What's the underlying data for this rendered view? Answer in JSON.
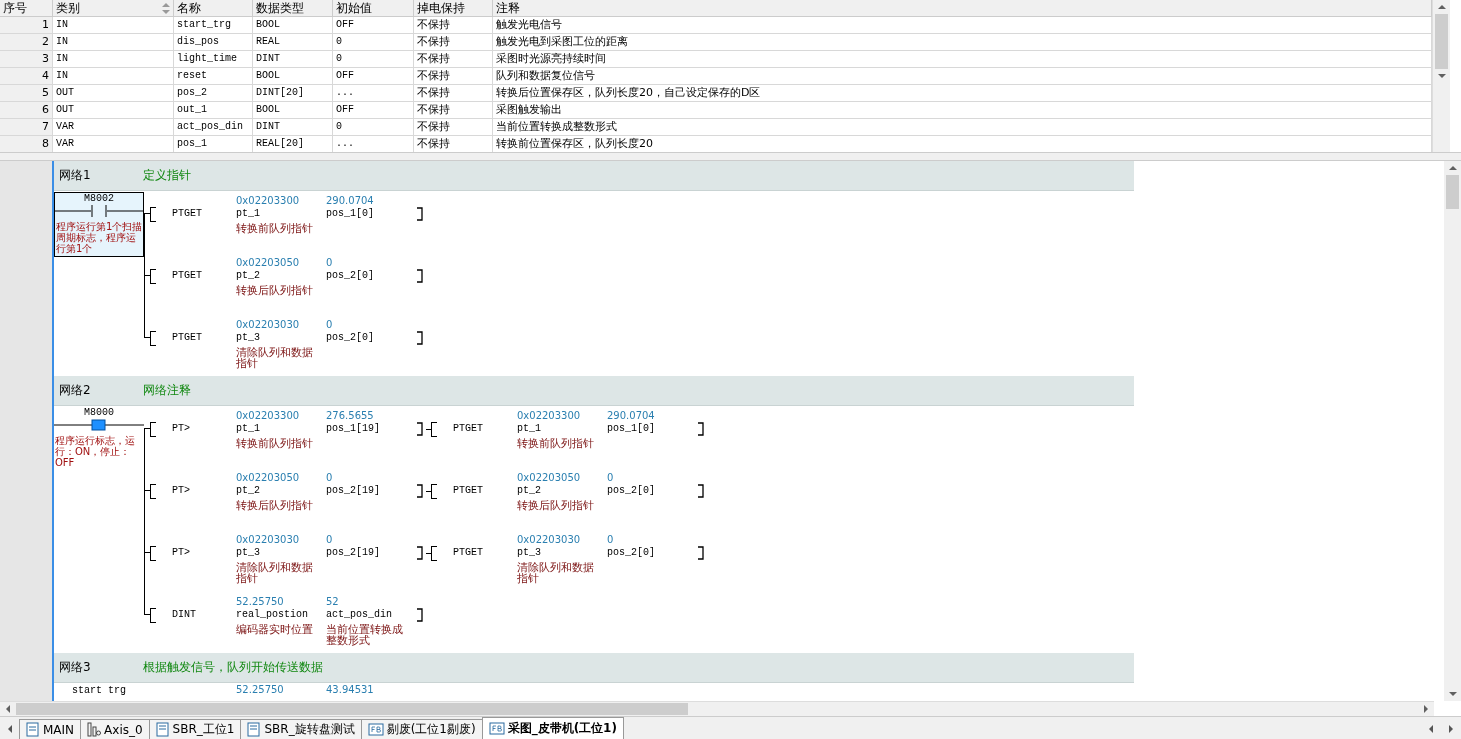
{
  "variable_table": {
    "columns": [
      {
        "label": "序号",
        "sortable": false
      },
      {
        "label": "类别",
        "sortable": true
      },
      {
        "label": "名称",
        "sortable": false
      },
      {
        "label": "数据类型",
        "sortable": false
      },
      {
        "label": "初始值",
        "sortable": false
      },
      {
        "label": "掉电保持",
        "sortable": false
      },
      {
        "label": "注释",
        "sortable": false
      }
    ],
    "rows": [
      {
        "index": "1",
        "category": "IN",
        "name": "start_trg",
        "type": "BOOL",
        "initial": "OFF",
        "retain": "不保持",
        "comment": "触发光电信号"
      },
      {
        "index": "2",
        "category": "IN",
        "name": "dis_pos",
        "type": "REAL",
        "initial": "0",
        "retain": "不保持",
        "comment": "触发光电到采图工位的距离"
      },
      {
        "index": "3",
        "category": "IN",
        "name": "light_time",
        "type": "DINT",
        "initial": "0",
        "retain": "不保持",
        "comment": "采图时光源亮持续时间"
      },
      {
        "index": "4",
        "category": "IN",
        "name": "reset",
        "type": "BOOL",
        "initial": "OFF",
        "retain": "不保持",
        "comment": "队列和数据复位信号"
      },
      {
        "index": "5",
        "category": "OUT",
        "name": "pos_2",
        "type": "DINT[20]",
        "initial": "...",
        "retain": "不保持",
        "comment": "转换后位置保存区，队列长度20，自己设定保存的D区"
      },
      {
        "index": "6",
        "category": "OUT",
        "name": "out_1",
        "type": "BOOL",
        "initial": "OFF",
        "retain": "不保持",
        "comment": "采图触发输出"
      },
      {
        "index": "7",
        "category": "VAR",
        "name": "act_pos_din",
        "type": "DINT",
        "initial": "0",
        "retain": "不保持",
        "comment": "当前位置转换成整数形式"
      },
      {
        "index": "8",
        "category": "VAR",
        "name": "pos_1",
        "type": "REAL[20]",
        "initial": "...",
        "retain": "不保持",
        "comment": "转换前位置保存区，队列长度20"
      }
    ]
  },
  "networks": [
    {
      "label": "网络1",
      "comment": "定义指针",
      "contact": {
        "address": "M8002",
        "comment": "程序运行第1个扫描周期标志，程序运行第1个",
        "selected": true,
        "energized": false
      },
      "rungs": [
        {
          "instructions": [
            {
              "op": "PTGET",
              "params": [
                {
                  "value": "0x02203300",
                  "name": "pt_1",
                  "comment": "转换前队列指针"
                },
                {
                  "value": "290.0704",
                  "name": "pos_1[0]"
                }
              ]
            }
          ]
        },
        {
          "instructions": [
            {
              "op": "PTGET",
              "params": [
                {
                  "value": "0x02203050",
                  "name": "pt_2",
                  "comment": "转换后队列指针"
                },
                {
                  "value": "0",
                  "name": "pos_2[0]"
                }
              ]
            }
          ]
        },
        {
          "instructions": [
            {
              "op": "PTGET",
              "params": [
                {
                  "value": "0x02203030",
                  "name": "pt_3",
                  "comment": "清除队列和数据指针"
                },
                {
                  "value": "0",
                  "name": "pos_2[0]"
                }
              ]
            }
          ]
        }
      ]
    },
    {
      "label": "网络2",
      "comment": "网络注释",
      "contact": {
        "address": "M8000",
        "comment": "程序运行标志，运行：ON，停止：OFF",
        "selected": false,
        "energized": true
      },
      "rungs": [
        {
          "instructions": [
            {
              "op": "PT>",
              "params": [
                {
                  "value": "0x02203300",
                  "name": "pt_1",
                  "comment": "转换前队列指针"
                },
                {
                  "value": "276.5655",
                  "name": "pos_1[19]"
                }
              ]
            },
            {
              "op": "PTGET",
              "params": [
                {
                  "value": "0x02203300",
                  "name": "pt_1",
                  "comment": "转换前队列指针"
                },
                {
                  "value": "290.0704",
                  "name": "pos_1[0]"
                }
              ]
            }
          ]
        },
        {
          "instructions": [
            {
              "op": "PT>",
              "params": [
                {
                  "value": "0x02203050",
                  "name": "pt_2",
                  "comment": "转换后队列指针"
                },
                {
                  "value": "0",
                  "name": "pos_2[19]"
                }
              ]
            },
            {
              "op": "PTGET",
              "params": [
                {
                  "value": "0x02203050",
                  "name": "pt_2",
                  "comment": "转换后队列指针"
                },
                {
                  "value": "0",
                  "name": "pos_2[0]"
                }
              ]
            }
          ]
        },
        {
          "instructions": [
            {
              "op": "PT>",
              "params": [
                {
                  "value": "0x02203030",
                  "name": "pt_3",
                  "comment": "清除队列和数据指针"
                },
                {
                  "value": "0",
                  "name": "pos_2[19]"
                }
              ]
            },
            {
              "op": "PTGET",
              "params": [
                {
                  "value": "0x02203030",
                  "name": "pt_3",
                  "comment": "清除队列和数据指针"
                },
                {
                  "value": "0",
                  "name": "pos_2[0]"
                }
              ]
            }
          ]
        },
        {
          "instructions": [
            {
              "op": "DINT",
              "params": [
                {
                  "value": "52.25750",
                  "name": "real_postion",
                  "comment": "编码器实时位置"
                },
                {
                  "value": "52",
                  "name": "act_pos_din",
                  "comment": "当前位置转换成整数形式"
                }
              ]
            }
          ]
        }
      ]
    },
    {
      "label": "网络3",
      "comment": "根据触发信号，队列开始传送数据",
      "partial": {
        "contact": "start trg",
        "values": [
          "52.25750",
          "43.94531"
        ]
      }
    }
  ],
  "tabs": [
    {
      "label": "MAIN",
      "kind": "main",
      "selected": false
    },
    {
      "label": "Axis_0",
      "kind": "axis",
      "selected": false
    },
    {
      "label": "SBR_工位1",
      "kind": "sbr",
      "selected": false
    },
    {
      "label": "SBR_旋转盘测试",
      "kind": "sbr",
      "selected": false
    },
    {
      "label": "剔废(工位1剔废)",
      "kind": "fb",
      "selected": false
    },
    {
      "label": "采图_皮带机(工位1)",
      "kind": "fb",
      "selected": true
    }
  ]
}
